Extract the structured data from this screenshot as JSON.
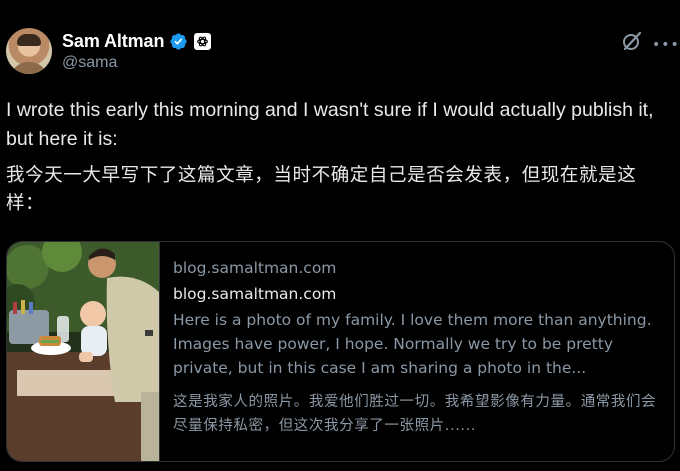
{
  "author": {
    "display_name": "Sam Altman",
    "handle": "@sama",
    "verified_icon": "verified-badge-icon",
    "affiliation_icon": "openai-logo-icon"
  },
  "actions": {
    "grok_icon": "grok-icon",
    "more_label": "•••"
  },
  "post": {
    "text_en": "I wrote this early this morning and I wasn't sure if I would actually publish it, but here it is:",
    "text_zh": "我今天一大早写下了这篇文章，当时不确定自己是否会发表，但现在就是这样："
  },
  "card": {
    "domain": "blog.samaltman.com",
    "title": "blog.samaltman.com",
    "description_en": "Here is a photo of my family. I love them more than anything. Images have power, I hope. Normally we try to be pretty private, but in this case I am sharing a photo in the...",
    "description_zh": "这是我家人的照片。我爱他们胜过一切。我希望影像有力量。通常我们会尽量保持私密，但这次我分享了一张照片......"
  },
  "colors": {
    "background": "#000000",
    "text_primary": "#e7e9ea",
    "text_secondary": "#8b98a5",
    "verified_blue": "#1d9bf0",
    "border": "#2f3336"
  }
}
